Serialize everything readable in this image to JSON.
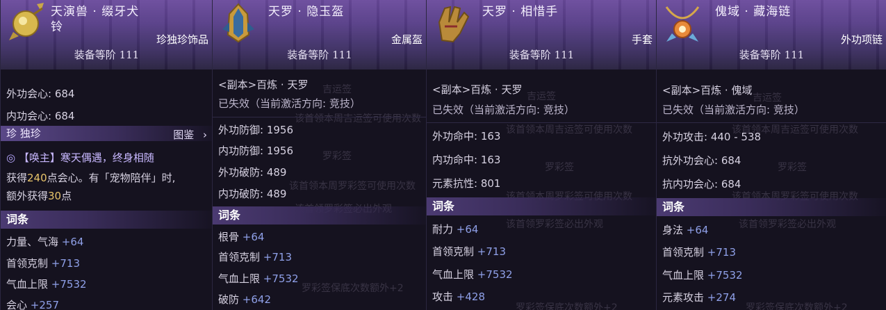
{
  "cards": [
    {
      "name_line1": "天演兽 · 缀牙犬",
      "name_line2": "铃",
      "type": "珍独珍饰品",
      "level": "装备等阶 111",
      "stats": [
        "外功会心: 684",
        "内功会心: 684"
      ],
      "rarity_band": "珍 独珍",
      "tujian": "图鉴",
      "effect_title": "【唤主】寒天偶遇，终身相随",
      "effect_line1_a": "获得",
      "effect_line1_b": "240",
      "effect_line1_c": "点会心。有「宠物陪伴」时,",
      "effect_line2_a": "额外获得",
      "effect_line2_b": "30",
      "effect_line2_c": "点",
      "affix_title": "词条",
      "affixes": [
        {
          "k": "力量、气海",
          "v": "+64"
        },
        {
          "k": "首领克制",
          "v": "+713"
        },
        {
          "k": "气血上限",
          "v": "+7532"
        },
        {
          "k": "会心",
          "v": "+257"
        }
      ]
    },
    {
      "name": "天罗 · 隐玉盔",
      "type": "金属盔",
      "level": "装备等阶 111",
      "source": "<副本>百炼 · 天罗",
      "status": "已失效（当前激活方向: 竞技）",
      "stats": [
        "外功防御: 1956",
        "内功防御: 1956",
        "外功破防: 489",
        "内功破防: 489"
      ],
      "affix_title": "词条",
      "affixes": [
        {
          "k": "根骨",
          "v": "+64"
        },
        {
          "k": "首领克制",
          "v": "+713"
        },
        {
          "k": "气血上限",
          "v": "+7532"
        },
        {
          "k": "破防",
          "v": "+642"
        }
      ],
      "ghost": [
        "吉运签",
        "该首领本周吉运签可使用次数",
        "罗彩签",
        "该首领本周罗彩签可使用次数",
        "该首领罗彩签必出外观",
        "罗彩签保底次数额外+2"
      ]
    },
    {
      "name": "天罗 · 相惜手",
      "type": "手套",
      "level": "装备等阶 111",
      "source": "<副本>百炼 · 天罗",
      "status": "已失效（当前激活方向: 竞技）",
      "stats": [
        "外功命中: 163",
        "内功命中: 163",
        "元素抗性: 801"
      ],
      "affix_title": "词条",
      "affixes": [
        {
          "k": "耐力",
          "v": "+64"
        },
        {
          "k": "首领克制",
          "v": "+713"
        },
        {
          "k": "气血上限",
          "v": "+7532"
        },
        {
          "k": "攻击",
          "v": "+428"
        }
      ],
      "ghost": [
        "吉运签",
        "该首领本周吉运签可使用次数",
        "罗彩签",
        "该首领本周罗彩签可使用次数",
        "该首领罗彩签必出外观",
        "罗彩签保底次数额外+2"
      ]
    },
    {
      "name": "傀域 · 藏海链",
      "type": "外功项链",
      "level": "装备等阶 111",
      "source": "<副本>百炼 · 傀域",
      "status": "已失效（当前激活方向: 竞技）",
      "stats": [
        "外功攻击: 440 - 538",
        "抗外功会心: 684",
        "抗内功会心: 684"
      ],
      "affix_title": "词条",
      "affixes": [
        {
          "k": "身法",
          "v": "+64"
        },
        {
          "k": "首领克制",
          "v": "+713"
        },
        {
          "k": "气血上限",
          "v": "+7532"
        },
        {
          "k": "元素攻击",
          "v": "+274"
        }
      ],
      "ghost": [
        "吉运签",
        "该首领本周吉运签可使用次数",
        "罗彩签",
        "该首领本周罗彩签可使用次数",
        "该首领罗彩签必出外观",
        "罗彩签保底次数额外+2"
      ]
    }
  ],
  "colors": {
    "plus": "#8fa0e8",
    "highlight": "#e8c46a",
    "panel": "#15121f",
    "header": "#553c86"
  },
  "icons": [
    "bell-pendant-icon",
    "helmet-icon",
    "glove-icon",
    "necklace-icon",
    "arrow-right-icon",
    "swirl-icon"
  ]
}
